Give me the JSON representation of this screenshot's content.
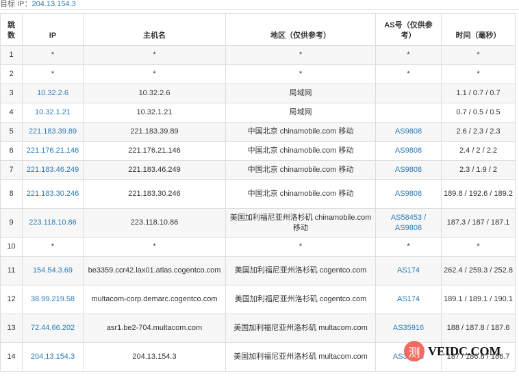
{
  "target": {
    "label": "目标 IP：",
    "value": "204.13.154.3"
  },
  "headers": [
    "跳数",
    "IP",
    "主机名",
    "地区（仅供参考）",
    "AS号（仅供参考）",
    "时间（毫秒）"
  ],
  "rows": [
    {
      "hop": "1",
      "ip": "*",
      "host": "*",
      "region": "*",
      "as": "*",
      "time": "*"
    },
    {
      "hop": "2",
      "ip": "*",
      "host": "*",
      "region": "*",
      "as": "*",
      "time": "*"
    },
    {
      "hop": "3",
      "ip": "10.32.2.6",
      "host": "10.32.2.6",
      "region": "局域网",
      "as": "",
      "time": "1.1 / 0.7 / 0.7"
    },
    {
      "hop": "4",
      "ip": "10.32.1.21",
      "host": "10.32.1.21",
      "region": "局域网",
      "as": "",
      "time": "0.7 / 0.5 / 0.5"
    },
    {
      "hop": "5",
      "ip": "221.183.39.89",
      "host": "221.183.39.89",
      "region": "中国北京 chinamobile.com 移动",
      "as": "AS9808",
      "time": "2.6 / 2.3 / 2.3"
    },
    {
      "hop": "6",
      "ip": "221.176.21.146",
      "host": "221.176.21.146",
      "region": "中国北京 chinamobile.com 移动",
      "as": "AS9808",
      "time": "2.4 / 2 / 2.2"
    },
    {
      "hop": "7",
      "ip": "221.183.46.249",
      "host": "221.183.46.249",
      "region": "中国北京 chinamobile.com 移动",
      "as": "AS9808",
      "time": "2.3 / 1.9 / 2"
    },
    {
      "hop": "8",
      "ip": "221.183.30.246",
      "host": "221.183.30.246",
      "region": "中国北京 chinamobile.com 移动",
      "as": "AS9808",
      "time": "189.8 / 192.6 / 189.2",
      "tall": true
    },
    {
      "hop": "9",
      "ip": "223.118.10.86",
      "host": "223.118.10.86",
      "region": "美国加利福尼亚州洛杉矶 chinamobile.com 移动",
      "as": "AS58453 / AS9808",
      "time": "187.3 / 187 / 187.1",
      "tall": true
    },
    {
      "hop": "10",
      "ip": "*",
      "host": "*",
      "region": "*",
      "as": "*",
      "time": "*"
    },
    {
      "hop": "11",
      "ip": "154.54.3.69",
      "host": "be3359.ccr42.lax01.atlas.cogentco.com",
      "region": "美国加利福尼亚州洛杉矶 cogentco.com",
      "as": "AS174",
      "time": "262.4 / 259.3 / 252.8",
      "tall": true
    },
    {
      "hop": "12",
      "ip": "38.99.219.58",
      "host": "multacom-corp.demarc.cogentco.com",
      "region": "美国加利福尼亚州洛杉矶 cogentco.com",
      "as": "AS174",
      "time": "189.1 / 189.1 / 190.1",
      "tall": true
    },
    {
      "hop": "13",
      "ip": "72.44.66.202",
      "host": "asr1.be2-704.multacom.com",
      "region": "美国加利福尼亚州洛杉矶 multacom.com",
      "as": "AS35916",
      "time": "188 / 187.8 / 187.6",
      "tall": true
    },
    {
      "hop": "14",
      "ip": "204.13.154.3",
      "host": "204.13.154.3",
      "region": "美国加利福尼亚州洛杉矶 multacom.com",
      "as": "AS35916",
      "time": "187 / 186.8 / 186.7",
      "tall": true
    }
  ],
  "watermark": {
    "circle": "测",
    "text": "VEIDC.COM"
  }
}
